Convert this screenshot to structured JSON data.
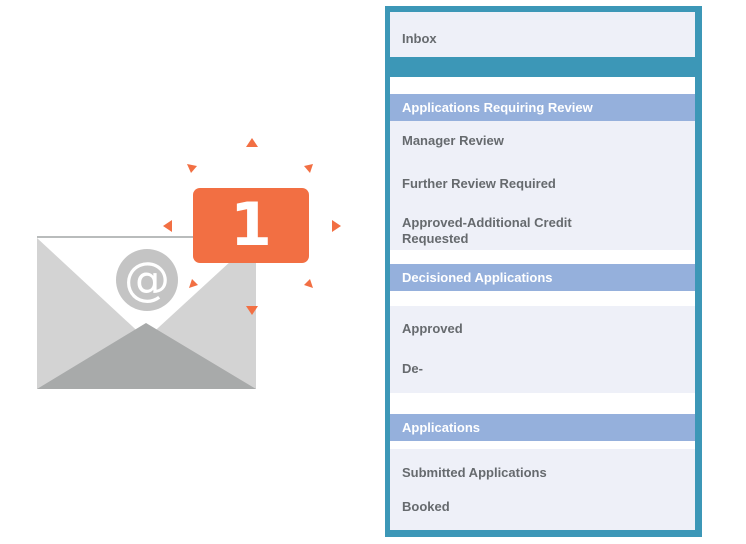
{
  "notification": {
    "count": "1",
    "at_symbol": "@",
    "badge_color": "#f26f43",
    "icons": [
      "envelope-icon",
      "at-icon"
    ]
  },
  "menu": {
    "inbox": "Inbox",
    "sections": [
      {
        "title": "Applications Requiring Review",
        "items": [
          "Manager Review",
          "Further Review Required",
          "Approved-Additional Credit Requested"
        ]
      },
      {
        "title": "Decisioned Applications",
        "items": [
          "Approved",
          "De-"
        ]
      },
      {
        "title": "Applications",
        "items": [
          "Submitted Applications",
          "Booked"
        ]
      }
    ],
    "colors": {
      "border": "#3c97b7",
      "section_header": "#95b0dc",
      "panel": "#eef0f8"
    }
  }
}
